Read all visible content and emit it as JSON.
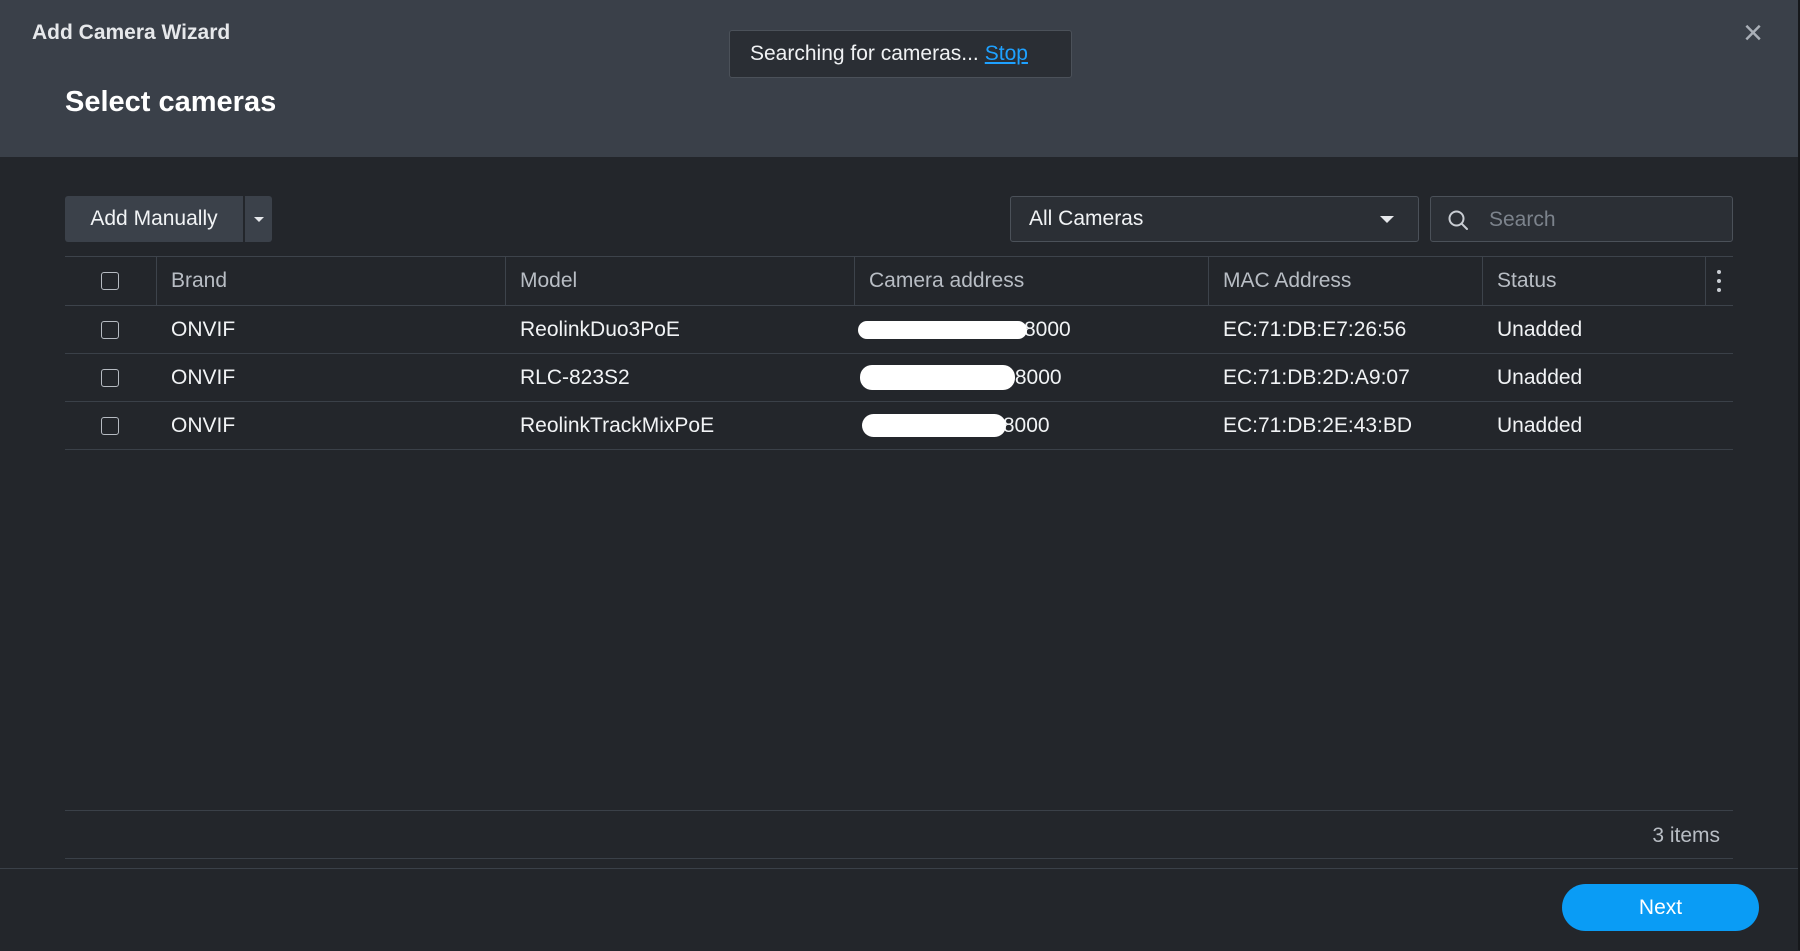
{
  "window": {
    "title": "Add Camera Wizard",
    "step_title": "Select cameras",
    "close_icon": "close-icon"
  },
  "toast": {
    "message": "Searching for cameras...",
    "action_label": "Stop"
  },
  "toolbar": {
    "add_button_label": "Add Manually",
    "filter": {
      "selected": "All Cameras"
    },
    "search": {
      "placeholder": "Search",
      "value": ""
    }
  },
  "table": {
    "columns": [
      "Brand",
      "Model",
      "Camera address",
      "MAC Address",
      "Status"
    ],
    "rows": [
      {
        "brand": "ONVIF",
        "model": "ReolinkDuo3PoE",
        "address": "8000",
        "mac": "EC:71:DB:E7:26:56",
        "status": "Unadded"
      },
      {
        "brand": "ONVIF",
        "model": "RLC-823S2",
        "address": ":8000",
        "mac": "EC:71:DB:2D:A9:07",
        "status": "Unadded"
      },
      {
        "brand": "ONVIF",
        "model": "ReolinkTrackMixPoE",
        "address": ":8000",
        "mac": "EC:71:DB:2E:43:BD",
        "status": "Unadded"
      }
    ],
    "item_count": "3 items"
  },
  "footer": {
    "next_label": "Next"
  },
  "colors": {
    "header_bg": "#3a4049",
    "body_bg": "#23262b",
    "accent": "#0a9cf5",
    "link": "#1ea1ff"
  }
}
